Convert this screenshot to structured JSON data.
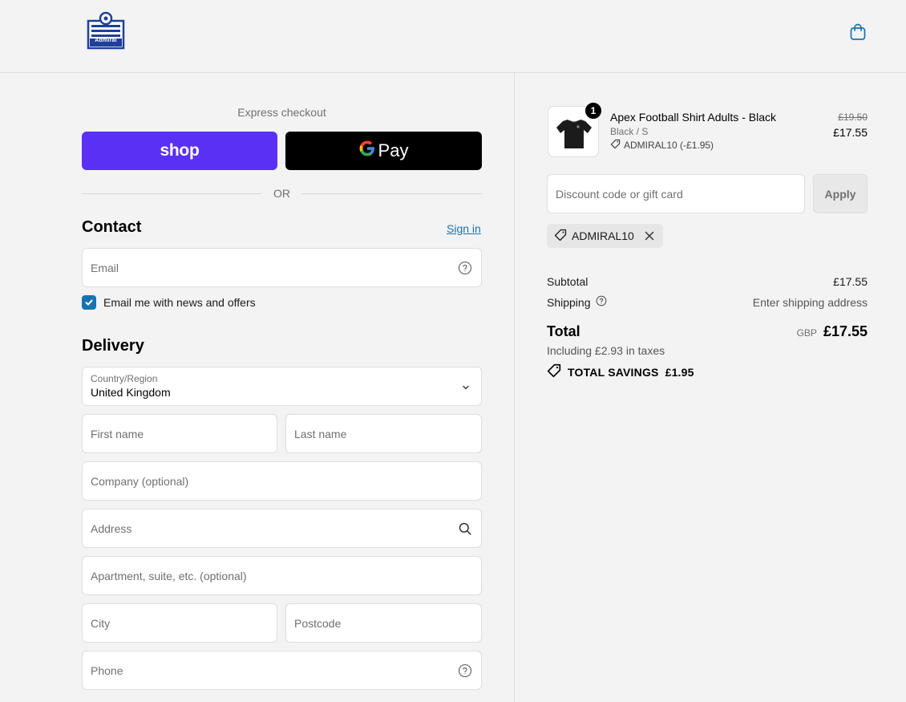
{
  "header": {
    "logo_text": "Admiral"
  },
  "express": {
    "title": "Express checkout",
    "shop_label": "shop",
    "gpay_label": "Pay",
    "or_label": "OR"
  },
  "contact": {
    "title": "Contact",
    "signin_label": "Sign in",
    "email_placeholder": "Email",
    "news_label": "Email me with news and offers",
    "news_checked": true
  },
  "delivery": {
    "title": "Delivery",
    "country_label": "Country/Region",
    "country_value": "United Kingdom",
    "first_name_placeholder": "First name",
    "last_name_placeholder": "Last name",
    "company_placeholder": "Company (optional)",
    "address_placeholder": "Address",
    "apartment_placeholder": "Apartment, suite, etc. (optional)",
    "city_placeholder": "City",
    "postcode_placeholder": "Postcode",
    "phone_placeholder": "Phone"
  },
  "summary": {
    "product": {
      "quantity": "1",
      "name": "Apex Football Shirt Adults - Black",
      "variant": "Black / S",
      "discount": "ADMIRAL10 (-£1.95)",
      "price_old": "£19.50",
      "price_new": "£17.55"
    },
    "discount_placeholder": "Discount code or gift card",
    "apply_label": "Apply",
    "applied_code": "ADMIRAL10",
    "subtotal_label": "Subtotal",
    "subtotal_value": "£17.55",
    "shipping_label": "Shipping",
    "shipping_value": "Enter shipping address",
    "total_label": "Total",
    "currency": "GBP",
    "total_value": "£17.55",
    "taxes_note": "Including £2.93 in taxes",
    "savings_label": "TOTAL SAVINGS",
    "savings_value": "£1.95"
  },
  "colors": {
    "shop_purple": "#5a31f4",
    "link_blue": "#1773b0",
    "background": "#f3f3f4"
  }
}
